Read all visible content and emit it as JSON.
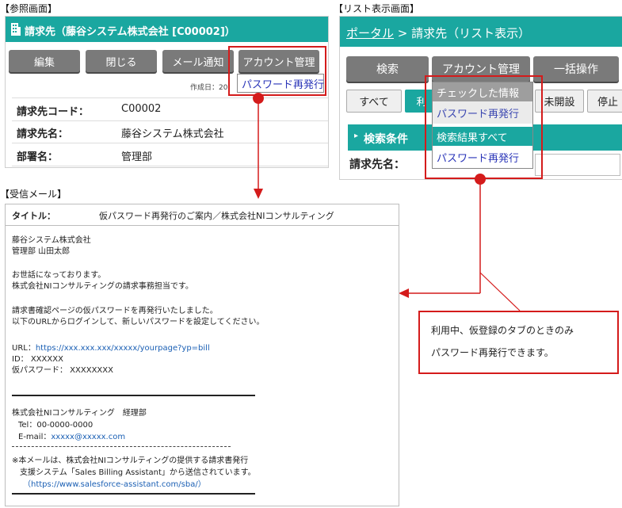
{
  "captions": {
    "reference": "【参照画面】",
    "list": "【リスト表示画面】",
    "mail": "【受信メール】"
  },
  "reference_screen": {
    "title": "請求先（藤谷システム株式会社 [C00002]）",
    "buttons": [
      "編集",
      "閉じる",
      "メール通知",
      "アカウント管理"
    ],
    "created_label": "作成日：20",
    "popup_item": "パスワード再発行",
    "fields": [
      {
        "label": "請求先コード：",
        "value": "C00002"
      },
      {
        "label": "請求先名：",
        "value": "藤谷システム株式会社"
      },
      {
        "label": "部署名：",
        "value": "管理部"
      }
    ]
  },
  "list_screen": {
    "breadcrumb_link": "ポータル",
    "breadcrumb_rest": " > 請求先（リスト表示）",
    "buttons": [
      "検索",
      "アカウント管理",
      "一括操作"
    ],
    "tabs": [
      "すべて",
      "利",
      "未開設",
      "停止"
    ],
    "section_title": "検索条件",
    "field_label": "請求先名：",
    "dropdown_items": [
      "チェックした情報",
      "パスワード再発行",
      "検索結果すべて",
      "パスワード再発行"
    ]
  },
  "mail": {
    "title_label": "タイトル：",
    "title_value": "仮パスワード再発行のご案内／株式会社NIコンサルティング",
    "to_company": "藤谷システム株式会社",
    "to_person": "管理部 山田太郎",
    "greeting1": "お世話になっております。",
    "greeting2": "株式会社NIコンサルティングの請求事務担当です。",
    "body1": "請求書確認ページの仮パスワードを再発行いたしました。",
    "body2": "以下のURLからログインして、新しいパスワードを設定してください。",
    "url_label": "URL：",
    "url_value": "https://xxx.xxx.xxx/xxxxx/yourpage?yp=bill",
    "id_line": "ID： XXXXXX",
    "pw_line": "仮パスワード： XXXXXXXX",
    "sig_company": "株式会社NIコンサルティング　経理部",
    "sig_tel": "Tel：00-0000-0000",
    "sig_email_label": "E-mail：",
    "sig_email": "xxxxx@xxxxx.com",
    "footer1": "※本メールは、株式会社NIコンサルティングの提供する請求書発行",
    "footer2": "支援システム「Sales Billing Assistant」から送信されています。",
    "footer3": "（https://www.salesforce-assistant.com/sba/）"
  },
  "note": {
    "line1": "利用中、仮登録のタブのときのみ",
    "line2": "パスワード再発行できます。"
  },
  "colors": {
    "teal": "#1aa7a0",
    "red": "#d41b1b",
    "button_gray": "#7a7a7a",
    "link_blue": "#1a5fb4"
  }
}
